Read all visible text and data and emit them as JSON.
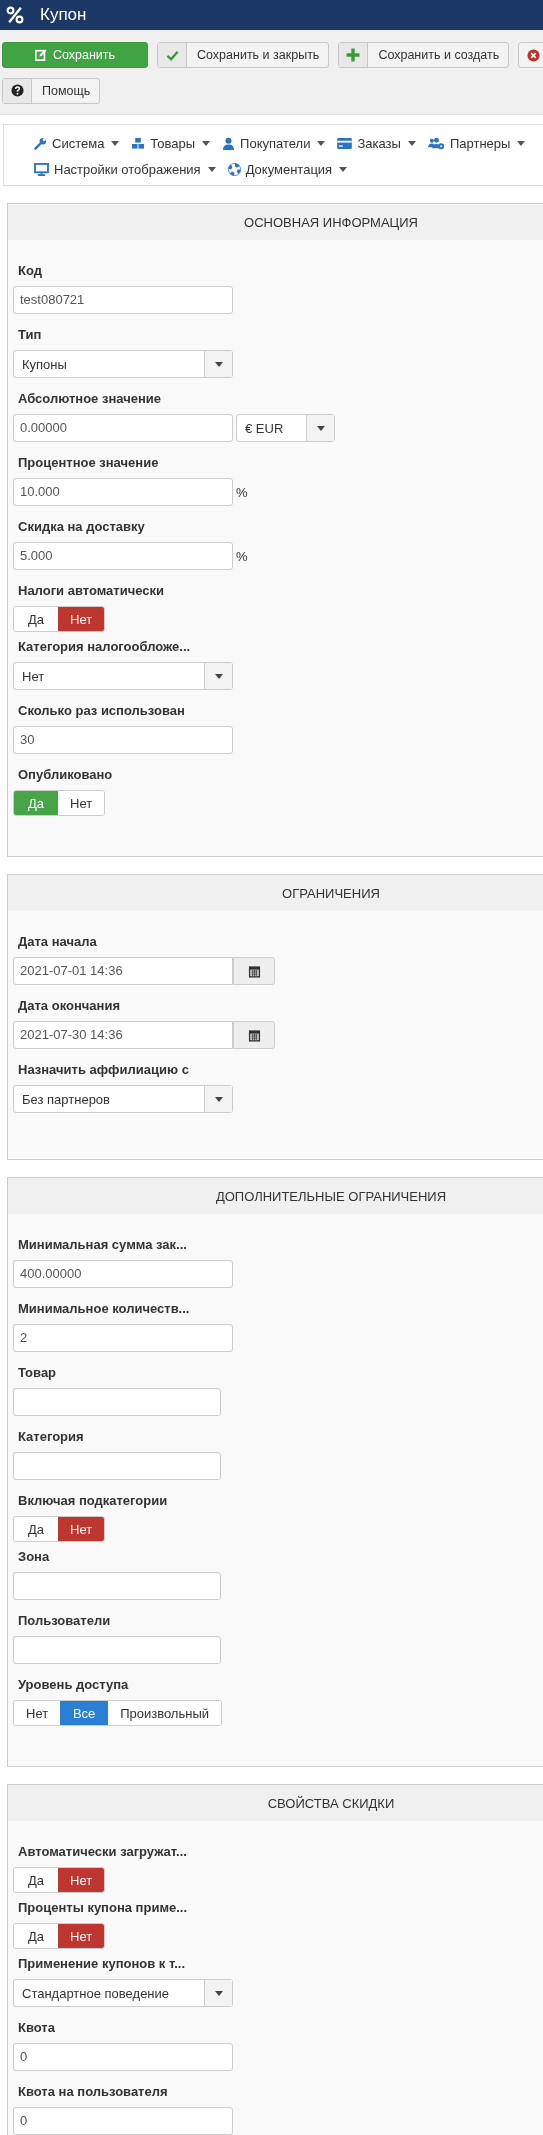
{
  "header": {
    "title": "Купон"
  },
  "toolbar": {
    "buttons": [
      {
        "label": "Сохранить",
        "kind": "primary"
      },
      {
        "label": "Сохранить и закрыть",
        "kind": "default"
      },
      {
        "label": "Сохранить и создать",
        "kind": "default"
      },
      {
        "kind": "cut"
      },
      {
        "label": "Помощь",
        "kind": "default"
      }
    ]
  },
  "menu": {
    "items": [
      {
        "label": "Система"
      },
      {
        "label": "Товары"
      },
      {
        "label": "Покупатели"
      },
      {
        "label": "Заказы"
      },
      {
        "label": "Партнеры"
      },
      {
        "label": "Настройки отображения"
      },
      {
        "label": "Документация"
      }
    ]
  },
  "sections": [
    {
      "title": "ОСНОВНАЯ ИНФОРМАЦИЯ",
      "fields": [
        {
          "label": "Код",
          "kind": "text",
          "value": "test080721"
        },
        {
          "label": "Тип",
          "kind": "select",
          "value": "Купоны"
        },
        {
          "label": "Абсолютное значение",
          "kind": "currency",
          "value": "0.00000",
          "currency": "€ EUR"
        },
        {
          "label": "Процентное значение",
          "kind": "text",
          "value": "10.000",
          "suffix": "%"
        },
        {
          "label": "Скидка на доставку",
          "kind": "text",
          "value": "5.000",
          "suffix": "%"
        },
        {
          "label": "Налоги автоматически",
          "kind": "toggle",
          "options": [
            {
              "label": "Да",
              "kind": "yes",
              "selected": false
            },
            {
              "label": "Нет",
              "kind": "no",
              "selected": true
            }
          ]
        },
        {
          "label": "Категория налогообложе...",
          "kind": "select",
          "value": "Нет"
        },
        {
          "label": "Сколько раз использован",
          "kind": "text",
          "value": "30"
        },
        {
          "label": "Опубликовано",
          "kind": "toggle",
          "options": [
            {
              "label": "Да",
              "kind": "yes",
              "selected": true
            },
            {
              "label": "Нет",
              "kind": "no",
              "selected": false
            }
          ]
        }
      ]
    },
    {
      "title": "ОГРАНИЧЕНИЯ",
      "fields": [
        {
          "label": "Дата начала",
          "kind": "date",
          "value": "2021-07-01 14:36"
        },
        {
          "label": "Дата окончания",
          "kind": "date",
          "value": "2021-07-30 14:36"
        },
        {
          "label": "Назначить аффилиацию с",
          "kind": "select",
          "value": "Без партнеров"
        }
      ]
    },
    {
      "title": "ДОПОЛНИТЕЛЬНЫЕ ОГРАНИЧЕНИЯ",
      "fields": [
        {
          "label": "Минимальная сумма зак...",
          "kind": "text",
          "value": "400.00000"
        },
        {
          "label": "Минимальное количеств...",
          "kind": "text",
          "value": "2"
        },
        {
          "label": "Товар",
          "kind": "text"
        },
        {
          "label": "Категория",
          "kind": "text"
        },
        {
          "label": "Включая подкатегории",
          "kind": "toggle",
          "options": [
            {
              "label": "Да",
              "kind": "yes",
              "selected": false
            },
            {
              "label": "Нет",
              "kind": "no",
              "selected": true
            }
          ]
        },
        {
          "label": "Зона",
          "kind": "text"
        },
        {
          "label": "Пользователи",
          "kind": "text"
        },
        {
          "label": "Уровень доступа",
          "kind": "toggle",
          "options": [
            {
              "label": "Нет",
              "kind": "no",
              "selected": false
            },
            {
              "label": "Все",
              "kind": "all",
              "selected": true
            },
            {
              "label": "Произвольный",
              "kind": "custom",
              "selected": false
            }
          ]
        }
      ]
    },
    {
      "title": "СВОЙСТВА СКИДКИ",
      "fields": [
        {
          "label": "Автоматически загружат...",
          "kind": "toggle",
          "options": [
            {
              "label": "Да",
              "kind": "yes",
              "selected": false
            },
            {
              "label": "Нет",
              "kind": "no",
              "selected": true
            }
          ]
        },
        {
          "label": "Проценты купона приме...",
          "kind": "toggle",
          "options": [
            {
              "label": "Да",
              "kind": "yes",
              "selected": false
            },
            {
              "label": "Нет",
              "kind": "no",
              "selected": true
            }
          ]
        },
        {
          "label": "Применение купонов к т...",
          "kind": "select",
          "value": "Стандартное поведение"
        },
        {
          "label": "Квота",
          "kind": "text",
          "value": "0"
        },
        {
          "label": "Квота на пользователя",
          "kind": "text",
          "value": "0"
        }
      ]
    }
  ]
}
